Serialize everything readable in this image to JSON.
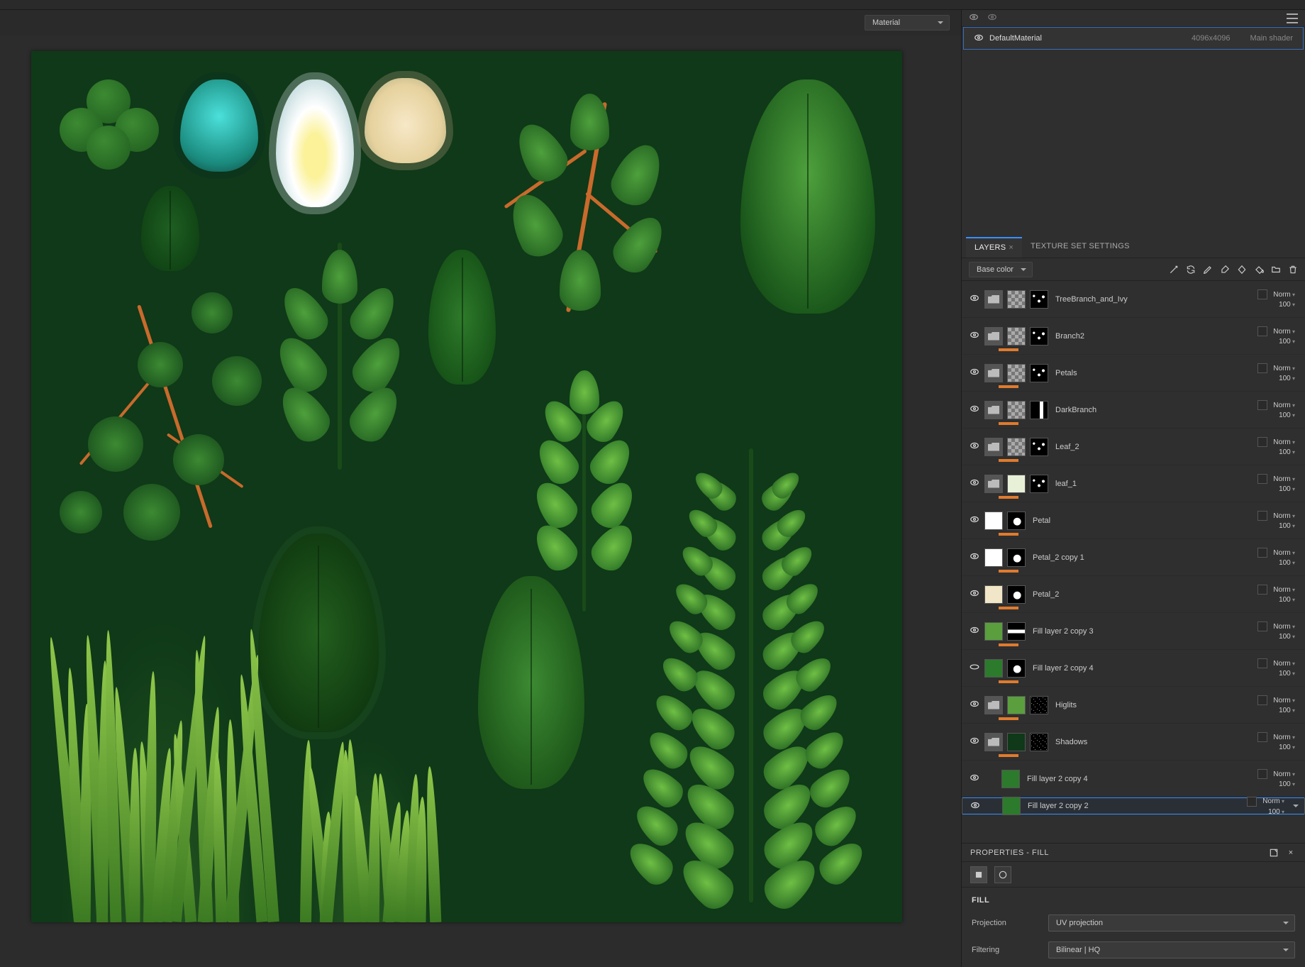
{
  "viewport": {
    "mode_dropdown": "Material"
  },
  "texture_sets": {
    "header_icons": [
      "layer-visibility",
      "effect-visibility"
    ],
    "items": [
      {
        "name": "DefaultMaterial",
        "resolution": "4096x4096",
        "shader": "Main shader"
      }
    ]
  },
  "tabs": {
    "layers": "LAYERS",
    "texture_set_settings": "TEXTURE SET SETTINGS",
    "active": "layers"
  },
  "layers_bar": {
    "channel": "Base color",
    "tool_icons": [
      "magic-wand-icon",
      "refresh-icon",
      "pen-icon",
      "brush-icon",
      "diamond-icon",
      "bucket-icon",
      "folder-icon",
      "trash-icon"
    ]
  },
  "blend_label": "Norm",
  "opacity_label": "100",
  "layers": [
    {
      "name": "TreeBranch_and_Ivy",
      "type": "folder",
      "visible": true,
      "mask": "ml-shapes",
      "orange": false,
      "checker": true
    },
    {
      "name": "Branch2",
      "type": "folder",
      "visible": true,
      "mask": "ml-shapes",
      "orange": true,
      "checker": true
    },
    {
      "name": "Petals",
      "type": "folder",
      "visible": true,
      "mask": "ml-shapes",
      "orange": true,
      "checker": true
    },
    {
      "name": "DarkBranch",
      "type": "folder",
      "visible": true,
      "mask": "ml-bar",
      "orange": true,
      "checker": true
    },
    {
      "name": "Leaf_2",
      "type": "folder",
      "visible": true,
      "mask": "ml-shapes",
      "orange": true,
      "checker": true
    },
    {
      "name": "leaf_1",
      "type": "folder",
      "visible": true,
      "mask": "ml-shapes",
      "orange": true,
      "checker": false,
      "thumb_variant": "leafish"
    },
    {
      "name": "Petal",
      "type": "fill",
      "visible": true,
      "mask": "ml-white",
      "orange": true,
      "thumb_variant": "white"
    },
    {
      "name": "Petal_2 copy 1",
      "type": "fill",
      "visible": true,
      "mask": "ml-white",
      "orange": true,
      "thumb_variant": "white"
    },
    {
      "name": "Petal_2",
      "type": "fill",
      "visible": true,
      "mask": "ml-white",
      "orange": true,
      "thumb_variant": "cream"
    },
    {
      "name": "Fill layer 2 copy 3",
      "type": "fill",
      "visible": true,
      "mask": "ml-stripe",
      "orange": true,
      "thumb_variant": "lgreen"
    },
    {
      "name": "Fill layer 2 copy 4",
      "type": "fill",
      "visible": true,
      "mask": "ml-white",
      "orange": true,
      "thumb_variant": "green",
      "eye_variant": "oval"
    },
    {
      "name": "Higlits",
      "type": "folder",
      "visible": true,
      "mask": "ml-noise",
      "orange": true,
      "thumb_variant": "lgreen"
    },
    {
      "name": "Shadows",
      "type": "folder",
      "visible": true,
      "mask": "ml-noise",
      "orange": true,
      "thumb_variant": "dgreen"
    },
    {
      "name": "Fill layer 2 copy 4",
      "type": "fill",
      "visible": true,
      "mask": null,
      "orange": false,
      "thumb_variant": "green",
      "indent": true
    },
    {
      "name": "Fill layer 2 copy 2",
      "type": "fill",
      "visible": true,
      "mask": null,
      "orange": false,
      "thumb_variant": "green",
      "selected": true,
      "indent": true
    }
  ],
  "properties": {
    "title": "PROPERTIES - FILL",
    "section": "FILL",
    "projection": {
      "label": "Projection",
      "value": "UV projection"
    },
    "filtering": {
      "label": "Filtering",
      "value": "Bilinear | HQ"
    }
  }
}
